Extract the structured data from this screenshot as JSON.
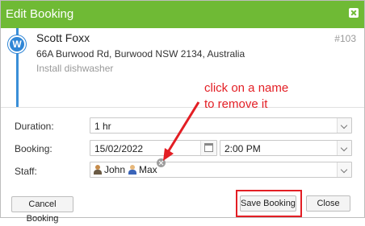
{
  "dialog": {
    "title": "Edit Booking"
  },
  "booking": {
    "avatar_initial": "W",
    "customer_name": "Scott Foxx",
    "address": "66A Burwood Rd, Burwood NSW 2134, Australia",
    "job": "Install dishwasher",
    "job_number": "#103"
  },
  "annotation": {
    "line1": "click on a name",
    "line2": "to remove it",
    "color": "#e31e24"
  },
  "form": {
    "duration_label": "Duration:",
    "duration_value": "1 hr",
    "booking_label": "Booking:",
    "date_value": "15/02/2022",
    "time_value": "2:00 PM",
    "staff_label": "Staff:",
    "staff": [
      {
        "name": "John",
        "icon": "person-icon"
      },
      {
        "name": "Max",
        "icon": "person-icon"
      }
    ]
  },
  "buttons": {
    "cancel_booking": "Cancel Booking",
    "save_booking": "Save Booking",
    "close": "Close"
  },
  "colors": {
    "titlebar": "#6fba35",
    "accent": "#2f86d6"
  }
}
